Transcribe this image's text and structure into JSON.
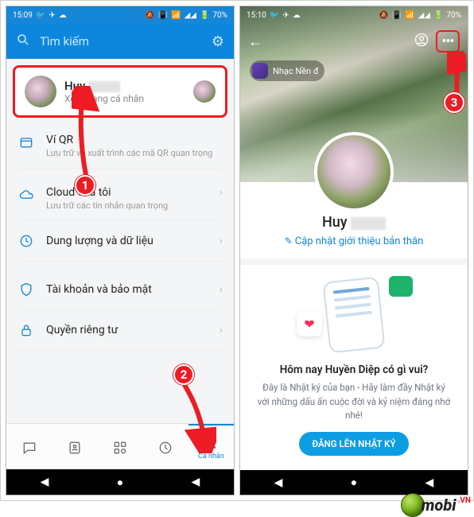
{
  "status": {
    "time": "15:09",
    "time2": "15:10",
    "battery": "70%"
  },
  "left": {
    "search_placeholder": "Tìm kiếm",
    "profile": {
      "name": "Huy",
      "sub": "Xem trang cá nhân"
    },
    "menu": {
      "qr": {
        "title": "Ví QR",
        "desc": "Lưu trữ và xuất trình các mã QR quan trọng"
      },
      "cloud": {
        "title": "Cloud của tôi",
        "desc": "Lưu trữ các tin nhắn quan trọng"
      },
      "data": {
        "title": "Dung lượng và dữ liệu"
      },
      "security": {
        "title": "Tài khoản và bảo mật"
      },
      "privacy": {
        "title": "Quyền riêng tư"
      }
    },
    "nav": {
      "personal": "Cá nhân"
    }
  },
  "right": {
    "music": "Nhạc Nền đ",
    "name": "Huy",
    "update_intro": "Cập nhật giới thiệu bản thân",
    "diary_q": "Hôm nay Huyền Diệp có gì vui?",
    "diary_d": "Đây là Nhật ký của bạn - Hãy làm đầy Nhật ký với những dấu ấn cuộc đời và kỷ niệm đáng nhớ nhé!",
    "diary_btn": "ĐĂNG LÊN NHẬT KÝ"
  },
  "annot": {
    "c1": "1",
    "c2": "2",
    "c3": "3"
  },
  "watermark": {
    "text": "mobi",
    "vn": ".VN"
  }
}
